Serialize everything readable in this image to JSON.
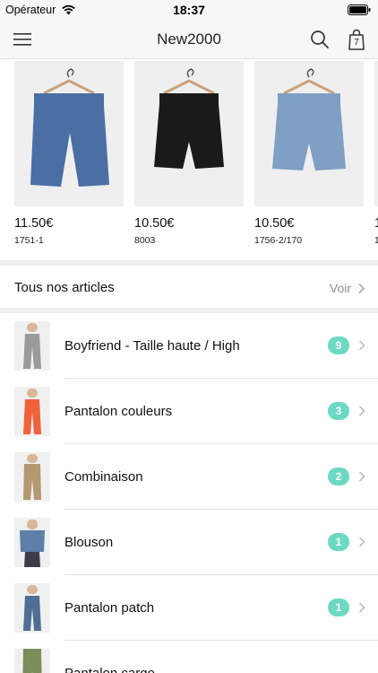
{
  "status_bar": {
    "carrier": "Opérateur",
    "time": "18:37"
  },
  "nav": {
    "title": "New2000",
    "cart_count": "7",
    "icons": [
      "menu-icon",
      "search-icon",
      "cart-icon"
    ]
  },
  "products": [
    {
      "price": "11.50€",
      "ref": "1751-1",
      "color": "#4a6fa5"
    },
    {
      "price": "10.50€",
      "ref": "8003",
      "color": "#1a1a1a"
    },
    {
      "price": "10.50€",
      "ref": "1756-2/170",
      "color": "#7f9fc4"
    },
    {
      "price": "1",
      "ref": "1",
      "color": "#c9c9c9"
    }
  ],
  "all_articles": {
    "title": "Tous nos articles",
    "link_label": "Voir"
  },
  "categories": [
    {
      "label": "Boyfriend - Taille haute / High",
      "count": "9",
      "color": "#9a9a9a"
    },
    {
      "label": "Pantalon couleurs",
      "count": "3",
      "color": "#f0623c"
    },
    {
      "label": "Combinaison",
      "count": "2",
      "color": "#b39870"
    },
    {
      "label": "Blouson",
      "count": "1",
      "color": "#5d7fa8"
    },
    {
      "label": "Pantalon patch",
      "count": "1",
      "color": "#4f6f96"
    },
    {
      "label": "Pantalon cargo",
      "count": "",
      "color": "#7e8c5a"
    }
  ],
  "colors": {
    "badge": "#6cd9c3",
    "bar_background": "#f7f7f7",
    "link_grey": "#8e8e8e"
  }
}
